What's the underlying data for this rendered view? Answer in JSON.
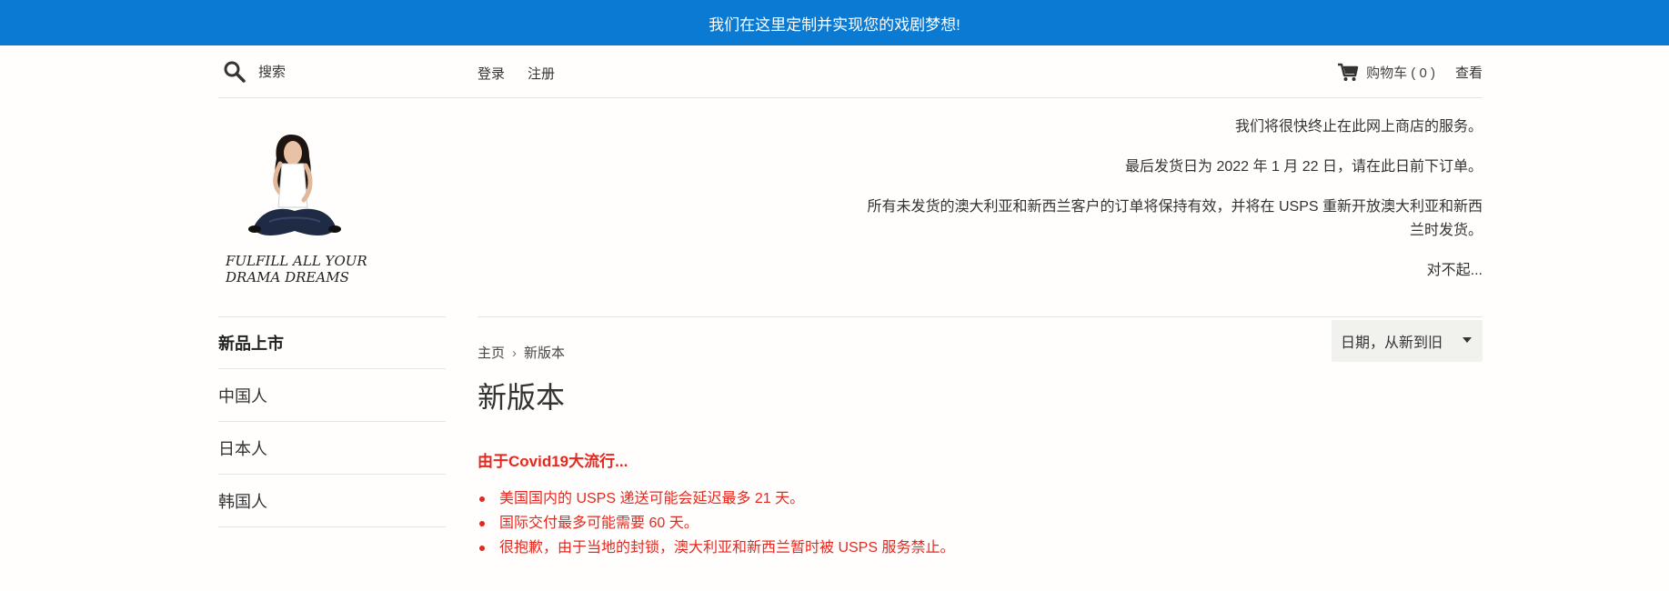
{
  "announcement": "我们在这里定制并实现您的戏剧梦想!",
  "header": {
    "search_placeholder": "搜索",
    "login": "登录",
    "register": "注册",
    "cart_label": "购物车 ( 0 )",
    "cart_view": "查看"
  },
  "logo": {
    "line1": "FULFILL ALL YOUR",
    "line2": "DRAMA DREAMS"
  },
  "notices": [
    "我们将很快终止在此网上商店的服务。",
    "最后发货日为 2022 年 1 月 22 日，请在此日前下订单。",
    "所有未发货的澳大利亚和新西兰客户的订单将保持有效，并将在 USPS 重新开放澳大利亚和新西兰时发货。",
    "对不起..."
  ],
  "sidebar": {
    "items": [
      {
        "label": "新品上市"
      },
      {
        "label": "中国人"
      },
      {
        "label": "日本人"
      },
      {
        "label": "韩国人"
      }
    ]
  },
  "breadcrumb": {
    "home": "主页",
    "separator": "›",
    "current": "新版本"
  },
  "page_title": "新版本",
  "sort": {
    "selected": "日期，从新到旧"
  },
  "covid": {
    "title": "由于Covid19大流行...",
    "items": [
      "美国国内的 USPS 递送可能会延迟最多 21 天。",
      "国际交付最多可能需要 60 天。",
      "很抱歉，由于当地的封锁，澳大利亚和新西兰暂时被 USPS 服务禁止。"
    ]
  },
  "colors": {
    "announcement_bg": "#0a7ad2",
    "alert_red": "#e5281f"
  }
}
